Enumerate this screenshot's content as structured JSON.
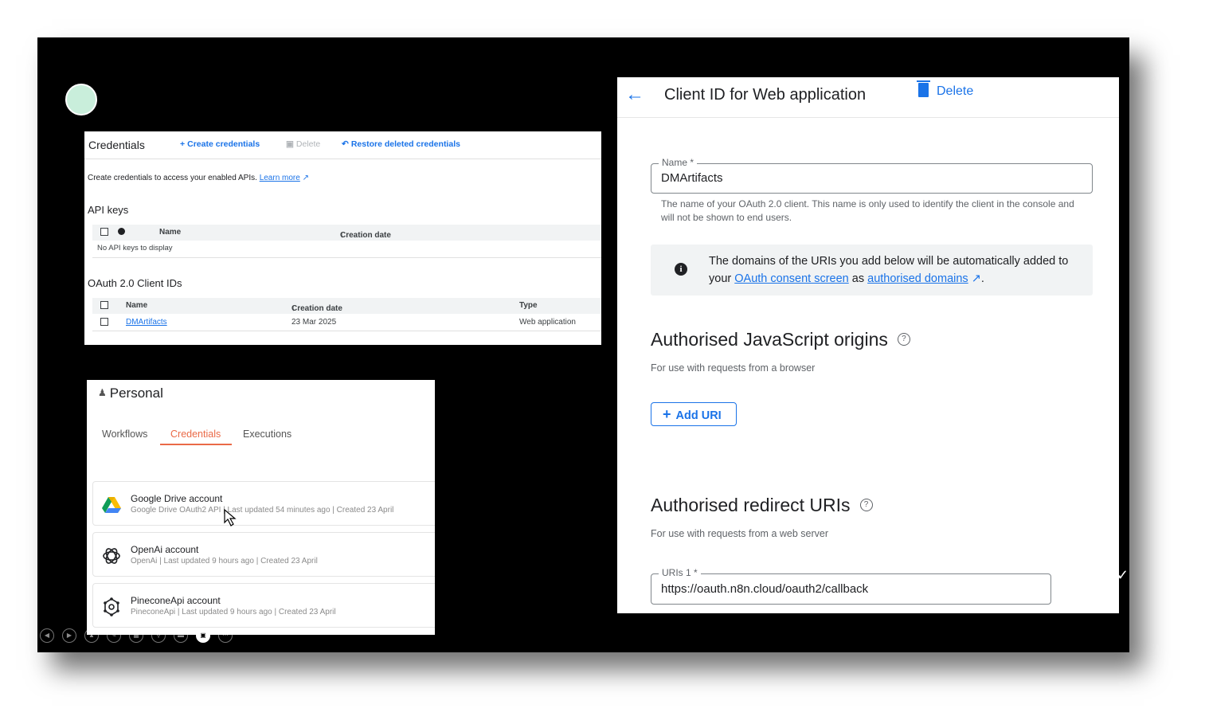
{
  "credentials": {
    "title": "Credentials",
    "actions": {
      "create": "Create credentials",
      "delete": "Delete",
      "restore": "Restore deleted credentials"
    },
    "info_text": "Create credentials to access your enabled APIs.",
    "learn_more": "Learn more",
    "api_keys": {
      "title": "API keys",
      "headers": {
        "name": "Name",
        "creation_date": "Creation date"
      },
      "empty": "No API keys to display"
    },
    "oauth": {
      "title": "OAuth 2.0 Client IDs",
      "headers": {
        "name": "Name",
        "creation_date": "Creation date",
        "type": "Type"
      },
      "rows": [
        {
          "name": "DMArtifacts",
          "creation_date": "23 Mar 2025",
          "type": "Web application"
        }
      ]
    }
  },
  "personal": {
    "title": "Personal",
    "tabs": [
      "Workflows",
      "Credentials",
      "Executions"
    ],
    "active_tab": "Credentials",
    "items": [
      {
        "name": "Google Drive account",
        "meta": "Google Drive OAuth2 API | Last updated 54 minutes ago | Created 23 April",
        "icon": "google-drive-icon"
      },
      {
        "name": "OpenAi account",
        "meta": "OpenAi | Last updated 9 hours ago | Created 23 April",
        "icon": "openai-icon"
      },
      {
        "name": "PineconeApi account",
        "meta": "PineconeApi | Last updated 9 hours ago | Created 23 April",
        "icon": "pinecone-icon"
      }
    ]
  },
  "client": {
    "title": "Client ID for Web application",
    "delete_label": "Delete",
    "name_label": "Name *",
    "name_value": "DMArtifacts",
    "name_hint": "The name of your OAuth 2.0 client. This name is only used to identify the client in the console and will not be shown to end users.",
    "note": {
      "prefix": "The domains of the URIs you add below will be automatically added to your",
      "link1": "OAuth consent screen",
      "middle": "as",
      "link2": "authorised domains",
      "suffix": "."
    },
    "js_origins": {
      "title": "Authorised JavaScript origins",
      "subtitle": "For use with requests from a browser",
      "add_label": "Add URI"
    },
    "redirect": {
      "title": "Authorised redirect URIs",
      "subtitle": "For use with requests from a web server",
      "uri_label": "URIs 1 *",
      "uri_value": "https://oauth.n8n.cloud/oauth2/callback"
    }
  },
  "colors": {
    "accent": "#1a73e8",
    "n8n_accent": "#ea6a47",
    "stage": "#000000"
  }
}
